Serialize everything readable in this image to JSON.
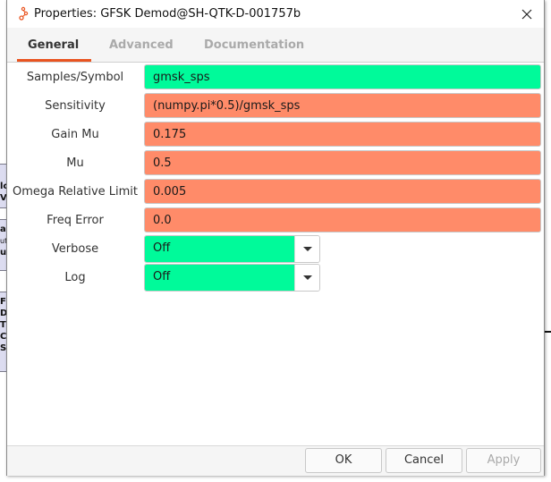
{
  "window": {
    "title": "Properties: GFSK Demod@SH-QTK-D-001757b",
    "app_icon": "gnuradio-icon",
    "close_icon": "close-icon"
  },
  "tabs": [
    {
      "label": "General",
      "active": true
    },
    {
      "label": "Advanced",
      "active": false
    },
    {
      "label": "Documentation",
      "active": false
    }
  ],
  "accent_color": "#e95420",
  "status_colors": {
    "valid": "#00fa9a",
    "evaluated": "#ff8b69"
  },
  "params": [
    {
      "label": "Samples/Symbol",
      "value": "gmsk_sps",
      "type": "text",
      "state": "valid"
    },
    {
      "label": "Sensitivity",
      "value": "(numpy.pi*0.5)/gmsk_sps",
      "type": "text",
      "state": "evaluated"
    },
    {
      "label": "Gain Mu",
      "value": "0.175",
      "type": "text",
      "state": "evaluated"
    },
    {
      "label": "Mu",
      "value": "0.5",
      "type": "text",
      "state": "evaluated"
    },
    {
      "label": "Omega Relative Limit",
      "value": "0.005",
      "type": "text",
      "state": "evaluated"
    },
    {
      "label": "Freq Error",
      "value": "0.0",
      "type": "text",
      "state": "evaluated"
    },
    {
      "label": "Verbose",
      "value": "Off",
      "type": "dropdown",
      "state": "valid"
    },
    {
      "label": "Log",
      "value": "Off",
      "type": "dropdown",
      "state": "valid"
    }
  ],
  "buttons": {
    "ok": "OK",
    "cancel": "Cancel",
    "apply": "Apply"
  },
  "background_fragments": {
    "block1": [
      "lc",
      "V"
    ],
    "block2": [
      "ar",
      "ut",
      "ue"
    ],
    "block3": [
      "F",
      "D",
      "T",
      "C",
      "S"
    ]
  }
}
